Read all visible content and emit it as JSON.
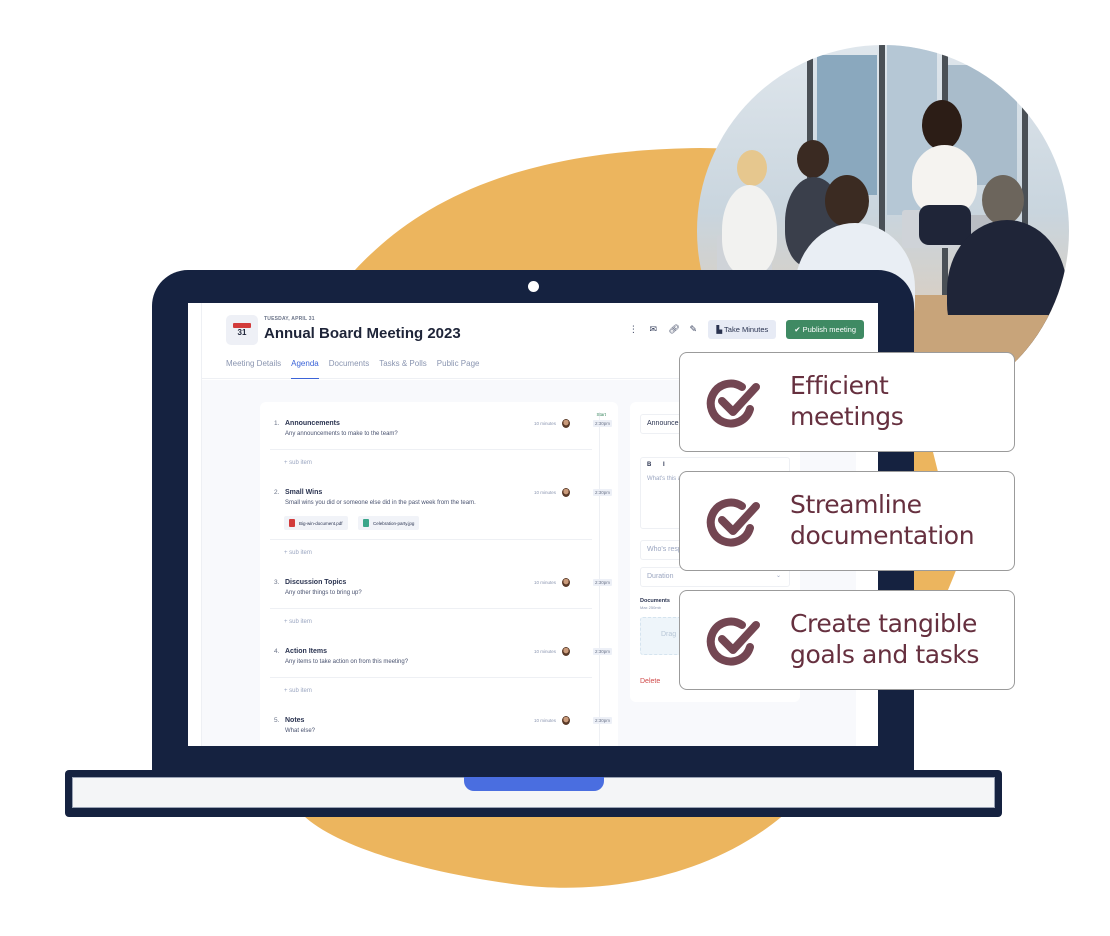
{
  "colors": {
    "blob": "#ECB55E",
    "laptop_frame": "#152240",
    "accent_blue": "#3B63D8",
    "publish_green": "#3F8A63",
    "feature_text": "#66303F",
    "delete_red": "#D04A4A"
  },
  "header": {
    "calendar_icon": {
      "month": "JAN",
      "day": "31"
    },
    "date_label": "TUESDAY, APRIL 31",
    "title": "Annual Board Meeting 2023",
    "toolbar": {
      "icons": [
        "more-vertical-icon",
        "mail-icon",
        "link-icon",
        "pencil-icon"
      ],
      "take_minutes_label": "Take Minutes",
      "publish_label": "Publish meeting"
    },
    "tabs": [
      {
        "label": "Meeting Details",
        "active": false
      },
      {
        "label": "Agenda",
        "active": true
      },
      {
        "label": "Documents",
        "active": false
      },
      {
        "label": "Tasks & Polls",
        "active": false
      },
      {
        "label": "Public Page",
        "active": false
      }
    ]
  },
  "agenda": {
    "start_label": "Start",
    "subitem_label": "sub item",
    "items": [
      {
        "number": "1.",
        "title": "Announcements",
        "description": "Any announcements to make to the team?",
        "duration": "10 minutes",
        "time": "2:30pm"
      },
      {
        "number": "2.",
        "title": "Small Wins",
        "description": "Small wins you did or someone else did in the past week from the team.",
        "duration": "10 minutes",
        "time": "2:30pm",
        "attachments": [
          {
            "name": "Big-win-document.pdf",
            "type": "pdf"
          },
          {
            "name": "Celebration-party.jpg",
            "type": "image"
          }
        ]
      },
      {
        "number": "3.",
        "title": "Discussion Topics",
        "description": "Any other things to bring up?",
        "duration": "10 minutes",
        "time": "2:30pm"
      },
      {
        "number": "4.",
        "title": "Action Items",
        "description": "Any items to take action on from this meeting?",
        "duration": "10 minutes",
        "time": "2:30pm"
      },
      {
        "number": "5.",
        "title": "Notes",
        "description": "What else?",
        "duration": "10 minutes",
        "time": "2:30pm"
      }
    ]
  },
  "side_panel": {
    "title_value": "Announcements",
    "editor_toolbar": "B I",
    "editor_placeholder": "What's this agenda item about?",
    "responsible_placeholder": "Who's responsible?",
    "duration_placeholder": "Duration",
    "documents_label": "Documents",
    "documents_max": "Max 250mb",
    "drop_label": "Drag",
    "delete_label": "Delete"
  },
  "features": [
    {
      "icon": "check-circle-icon",
      "line1": "Efficient",
      "line2": "meetings"
    },
    {
      "icon": "check-circle-icon",
      "line1": "Streamline",
      "line2": "documentation"
    },
    {
      "icon": "check-circle-icon",
      "line1": "Create tangible",
      "line2": "goals and tasks"
    }
  ]
}
